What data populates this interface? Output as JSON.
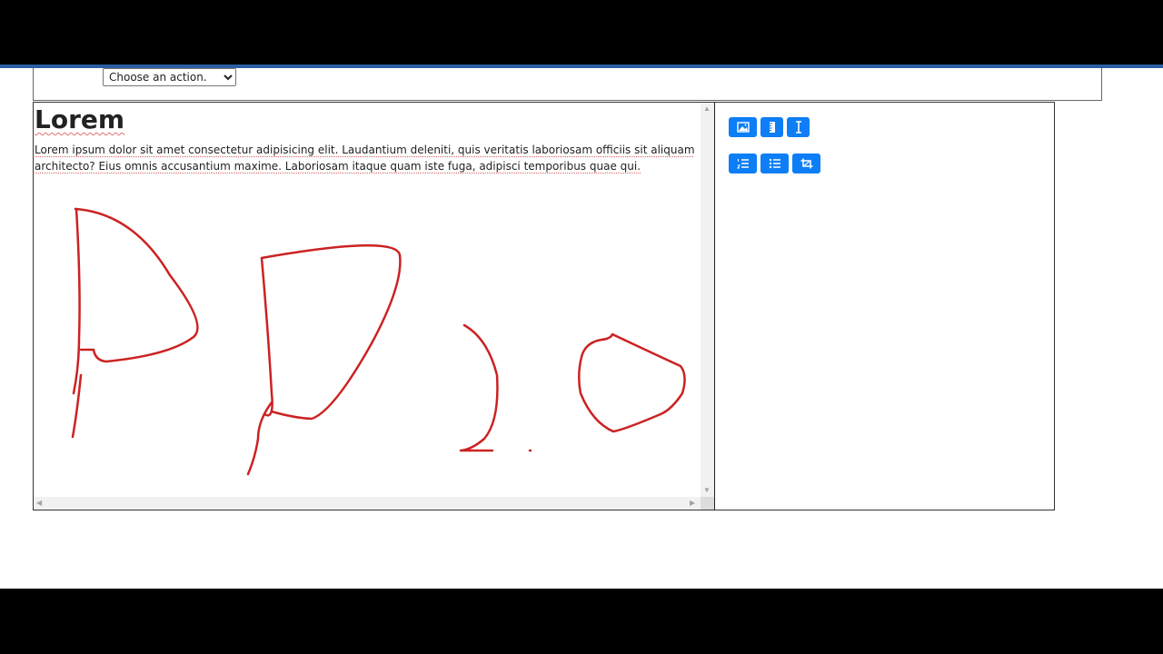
{
  "toolbar": {
    "action_select": {
      "selected": "Choose an action."
    }
  },
  "editor": {
    "title": "Lorem",
    "body": "Lorem ipsum dolor sit amet consectetur adipisicing elit. Laudantium deleniti, quis veritatis laboriosam officiis sit aliquam architecto? Eius omnis accusantium maxime. Laboriosam itaque quam iste fuga, adipisci temporibus quae qui."
  },
  "panel": {
    "buttons": [
      {
        "icon": "image-icon"
      },
      {
        "icon": "ruler-icon"
      },
      {
        "icon": "text-cursor-icon"
      },
      {
        "icon": "ordered-list-icon"
      },
      {
        "icon": "unordered-list-icon"
      },
      {
        "icon": "crop-icon"
      }
    ]
  },
  "colors": {
    "ink": "#cc2222",
    "button": "#0d7ef5",
    "accent_bar": "#2c5ea3"
  }
}
